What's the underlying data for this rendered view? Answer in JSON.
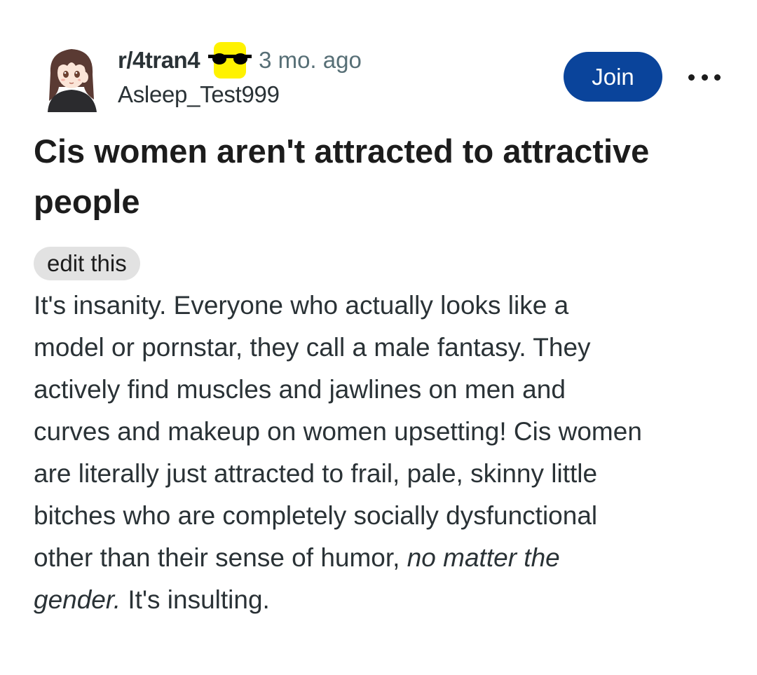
{
  "header": {
    "subreddit": "r/4tran4",
    "time": "3 mo. ago",
    "username": "Asleep_Test999",
    "join_label": "Join",
    "flair_icon": "yellow-sunglasses-icon",
    "more_icon": "more-horizontal-icon"
  },
  "post": {
    "title_line1": "Cis women aren't attracted to attractive",
    "title_line2": "people",
    "flair": "edit this",
    "body": {
      "l1": "It's insanity. Everyone who actually looks like a",
      "l2": "model or pornstar, they call a male fantasy. They",
      "l3": "actively find muscles and jawlines on men and",
      "l4": "curves and makeup on women upsetting! Cis women",
      "l5": "are literally just attracted to frail, pale, skinny little",
      "l6": "bitches who are completely socially dysfunctional",
      "l7_plain": "other than their sense of humor, ",
      "l7_italic": "no matter the",
      "l8_italic": "gender.",
      "l8_plain": " It's insulting."
    }
  },
  "colors": {
    "join_bg": "#0a449b",
    "meta_text": "#576f76",
    "flair_bg": "#e2e2e2",
    "icon_yellow": "#fff200"
  }
}
